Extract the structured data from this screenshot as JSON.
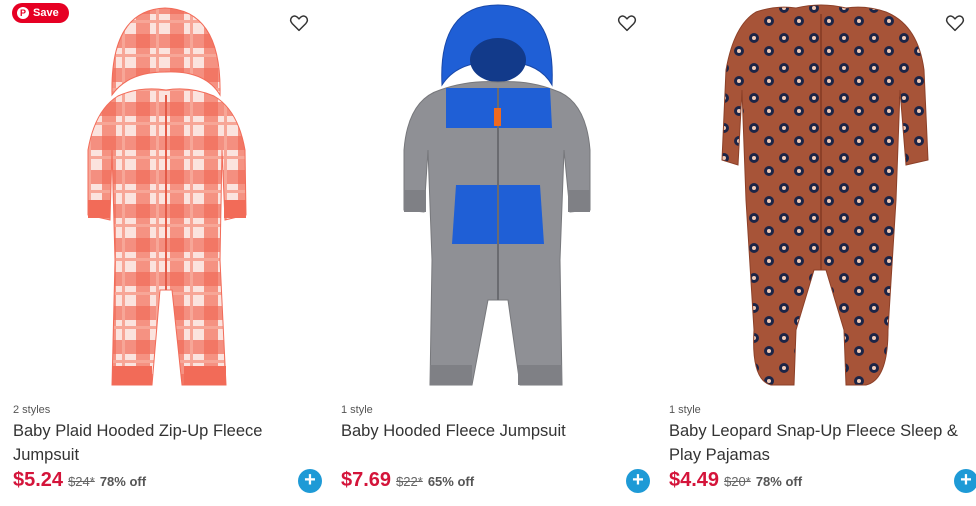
{
  "pinterest": {
    "save_label": "Save",
    "icon": "pinterest-icon"
  },
  "products": [
    {
      "styles": "2 styles",
      "title": "Baby Plaid Hooded Zip-Up Fleece Jumpsuit",
      "price": "$5.24",
      "original_price": "$24*",
      "discount": "78% off",
      "icons": {
        "favorite": "heart-outline-icon",
        "add": "plus-icon"
      }
    },
    {
      "styles": "1 style",
      "title": "Baby Hooded Fleece Jumpsuit",
      "price": "$7.69",
      "original_price": "$22*",
      "discount": "65% off",
      "icons": {
        "favorite": "heart-outline-icon",
        "add": "plus-icon"
      }
    },
    {
      "styles": "1 style",
      "title": "Baby Leopard Snap-Up Fleece Sleep & Play Pajamas",
      "price": "$4.49",
      "original_price": "$20*",
      "discount": "78% off",
      "icons": {
        "favorite": "heart-outline-icon",
        "add": "plus-icon"
      }
    }
  ],
  "colors": {
    "sale_price": "#d4143a",
    "add_button": "#1e9ad6",
    "pinterest": "#e60023"
  }
}
